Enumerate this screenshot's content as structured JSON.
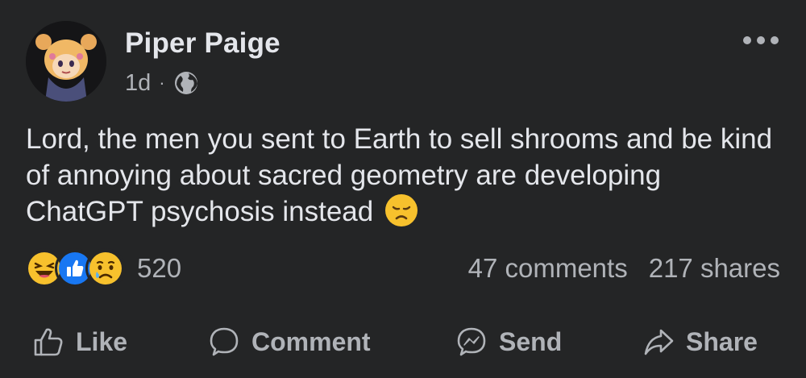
{
  "author": {
    "name": "Piper Paige",
    "time": "1d",
    "separator": "·",
    "audience_icon": "globe-icon"
  },
  "post": {
    "text": "Lord, the men you sent to Earth to sell shrooms and be kind of annoying about sacred geometry are developing ChatGPT psychosis instead",
    "trailing_emoji": "disappointed-face-emoji"
  },
  "reactions": {
    "icons": [
      "haha-reaction-icon",
      "like-reaction-icon",
      "sad-reaction-icon"
    ],
    "count": "520"
  },
  "stats": {
    "comments": "47 comments",
    "shares": "217 shares"
  },
  "actions": {
    "like": "Like",
    "comment": "Comment",
    "send": "Send",
    "share": "Share"
  },
  "colors": {
    "background": "#242526",
    "primary_text": "#e4e6eb",
    "secondary_text": "#b0b3b8",
    "like_blue": "#1877f2",
    "emoji_yellow": "#f7c12d"
  }
}
